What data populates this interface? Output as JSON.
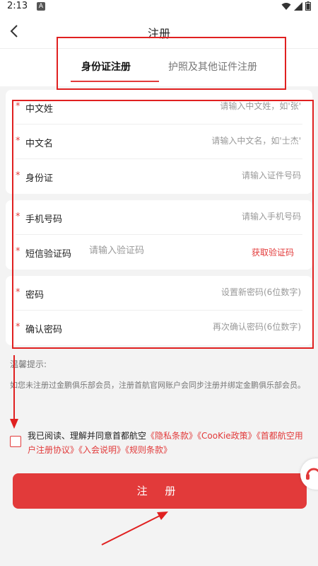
{
  "status_bar": {
    "time": "2:13",
    "notification_badge": "A"
  },
  "header": {
    "title": "注册",
    "back_icon": "chevron-left-icon"
  },
  "tabs": [
    {
      "label": "身份证注册",
      "active": true
    },
    {
      "label": "护照及其他证件注册",
      "active": false
    }
  ],
  "form": {
    "surname": {
      "label": "中文姓",
      "placeholder": "请输入中文姓，如'张'"
    },
    "given_name": {
      "label": "中文名",
      "placeholder": "请输入中文名，如'士杰'"
    },
    "id_card": {
      "label": "身份证",
      "placeholder": "请输入证件号码"
    },
    "phone": {
      "label": "手机号码",
      "placeholder": "请输入手机号码"
    },
    "sms_code": {
      "label": "短信验证码",
      "placeholder": "请输入验证码",
      "action": "获取验证码"
    },
    "password": {
      "label": "密码",
      "placeholder": "设置新密码(6位数字)"
    },
    "confirm_password": {
      "label": "确认密码",
      "placeholder": "再次确认密码(6位数字)"
    },
    "required_mark": "*"
  },
  "tips": {
    "title": "温馨提示:",
    "text": "如您未注册过金鹏俱乐部会员，注册首航官网账户会同步注册并绑定金鹏俱乐部会员。"
  },
  "agreement": {
    "prefix": "我已阅读、理解并同意首都航空",
    "links": [
      "《隐私条款》",
      "《CooKie政策》",
      "《首都航空用户注册协议》",
      "《入会说明》",
      "《规则条款》"
    ]
  },
  "submit_label": "注 册",
  "colors": {
    "accent": "#e23a3a",
    "annotation": "#e02020"
  }
}
